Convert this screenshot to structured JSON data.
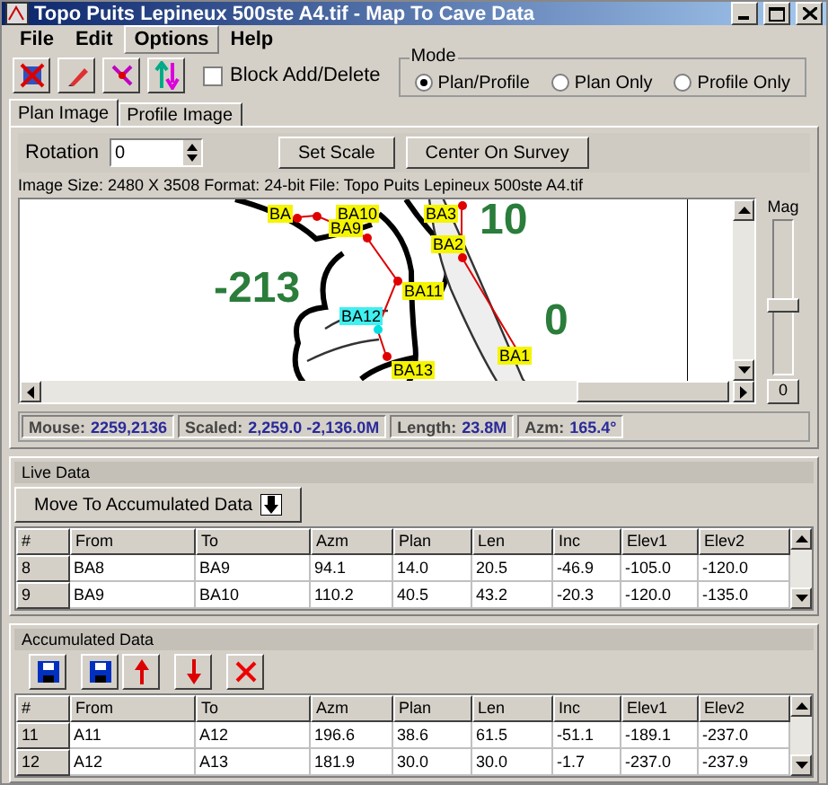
{
  "window": {
    "title": "Topo Puits Lepineux 500ste  A4.tif - Map To Cave Data"
  },
  "menu": [
    {
      "label": "File",
      "selected": false
    },
    {
      "label": "Edit",
      "selected": false
    },
    {
      "label": "Options",
      "selected": true
    },
    {
      "label": "Help",
      "selected": false
    }
  ],
  "toolbar": {
    "block_add_delete": {
      "label": "Block Add/Delete",
      "checked": false
    },
    "mode": {
      "title": "Mode",
      "options": [
        {
          "label": "Plan/Profile",
          "selected": true
        },
        {
          "label": "Plan Only",
          "selected": false
        },
        {
          "label": "Profile Only",
          "selected": false
        }
      ]
    }
  },
  "tabs": [
    {
      "label": "Plan Image",
      "selected": true
    },
    {
      "label": "Profile Image",
      "selected": false
    }
  ],
  "plan": {
    "rotation_label": "Rotation",
    "rotation": "0",
    "buttons": [
      "Set Scale",
      "Center On Survey"
    ],
    "image_info": "Image Size: 2480 X 3508 Format: 24-bit File: Topo Puits Lepineux 500ste  A4.tif",
    "stations": [
      {
        "label": "BA",
        "selected": false
      },
      {
        "label": "BA10",
        "selected": false
      },
      {
        "label": "BA3",
        "selected": false
      },
      {
        "label": "BA9",
        "selected": false
      },
      {
        "label": "BA2",
        "selected": false
      },
      {
        "label": "BA11",
        "selected": false
      },
      {
        "label": "BA12",
        "selected": true
      },
      {
        "label": "BA1",
        "selected": false
      },
      {
        "label": "BA13",
        "selected": false
      }
    ],
    "elevations": [
      "-213",
      "10",
      "0"
    ],
    "mag_label": "Mag",
    "mag_slider": {
      "level": 0.4
    },
    "mag_value": "0",
    "status": [
      {
        "label": "Mouse:",
        "value": "2259,2136"
      },
      {
        "label": "Scaled:",
        "value": "2,259.0 -2,136.0M"
      },
      {
        "label": "Length:",
        "value": "23.8M"
      },
      {
        "label": "Azm:",
        "value": "165.4°"
      }
    ]
  },
  "live_data": {
    "title": "Live Data",
    "button": "Move To Accumulated Data",
    "columns": [
      "#",
      "From",
      "To",
      "Azm",
      "Plan",
      "Len",
      "Inc",
      "Elev1",
      "Elev2"
    ],
    "rows": [
      [
        "8",
        "BA8",
        "BA9",
        "94.1",
        "14.0",
        "20.5",
        "-46.9",
        "-105.0",
        "-120.0"
      ],
      [
        "9",
        "BA9",
        "BA10",
        "110.2",
        "40.5",
        "43.2",
        "-20.3",
        "-120.0",
        "-135.0"
      ]
    ]
  },
  "accumulated_data": {
    "title": "Accumulated Data",
    "columns": [
      "#",
      "From",
      "To",
      "Azm",
      "Plan",
      "Len",
      "Inc",
      "Elev1",
      "Elev2"
    ],
    "rows": [
      [
        "11",
        "A11",
        "A12",
        "196.6",
        "38.6",
        "61.5",
        "-51.1",
        "-189.1",
        "-237.0"
      ],
      [
        "12",
        "A12",
        "A13",
        "181.9",
        "30.0",
        "30.0",
        "-1.7",
        "-237.0",
        "-237.9"
      ]
    ]
  }
}
